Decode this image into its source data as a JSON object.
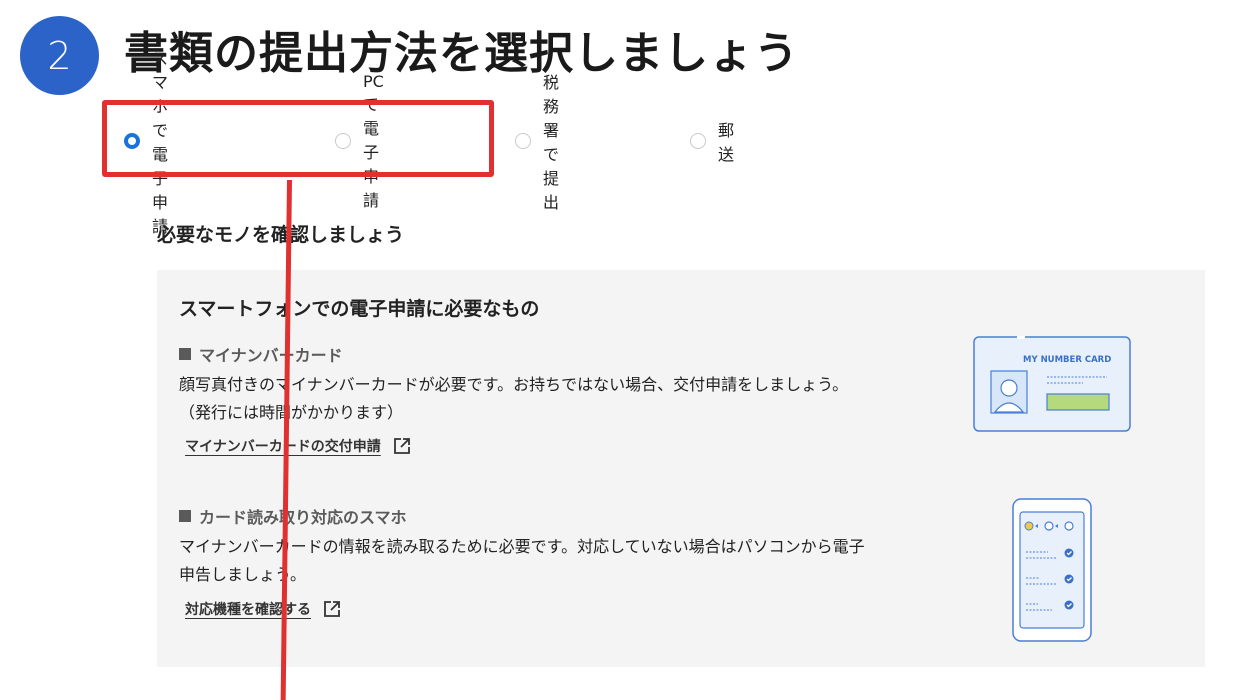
{
  "step": {
    "number": "2"
  },
  "title": "書類の提出方法を選択しましょう",
  "submission_options": [
    {
      "label": "スマホで電子申請",
      "selected": true
    },
    {
      "label": "PCで電子申請",
      "selected": false
    },
    {
      "label": "税務署で提出",
      "selected": false
    },
    {
      "label": "郵送",
      "selected": false
    }
  ],
  "requirements": {
    "section_title": "必要なモノを確認しましょう",
    "panel_heading": "スマートフォンでの電子申請に必要なもの",
    "items": [
      {
        "title": "マイナンバーカード",
        "description_lines": [
          "顔写真付きのマイナンバーカードが必要です。お持ちではない場合、交付申請をしましょう。",
          "（発行には時間がかかります）"
        ],
        "link": "マイナンバーカードの交付申請",
        "illustration_text": "MY NUMBER  CARD",
        "icon": "id-card-illustration"
      },
      {
        "title": "カード読み取り対応のスマホ",
        "description_lines": [
          "マイナンバーカードの情報を読み取るために必要です。対応していない場合はパソコンから電子",
          "申告しましょう。"
        ],
        "link": "対応機種を確認する",
        "icon": "smartphone-illustration"
      }
    ]
  },
  "colors": {
    "accent": "#2b63c8",
    "radio": "#1a73d9",
    "annotation": "#e03030",
    "panel_bg": "#f5f4f4",
    "card_green": "#b5da7d"
  },
  "icons": {
    "link": "external-link-icon",
    "bullet": "square-bullet-icon"
  }
}
